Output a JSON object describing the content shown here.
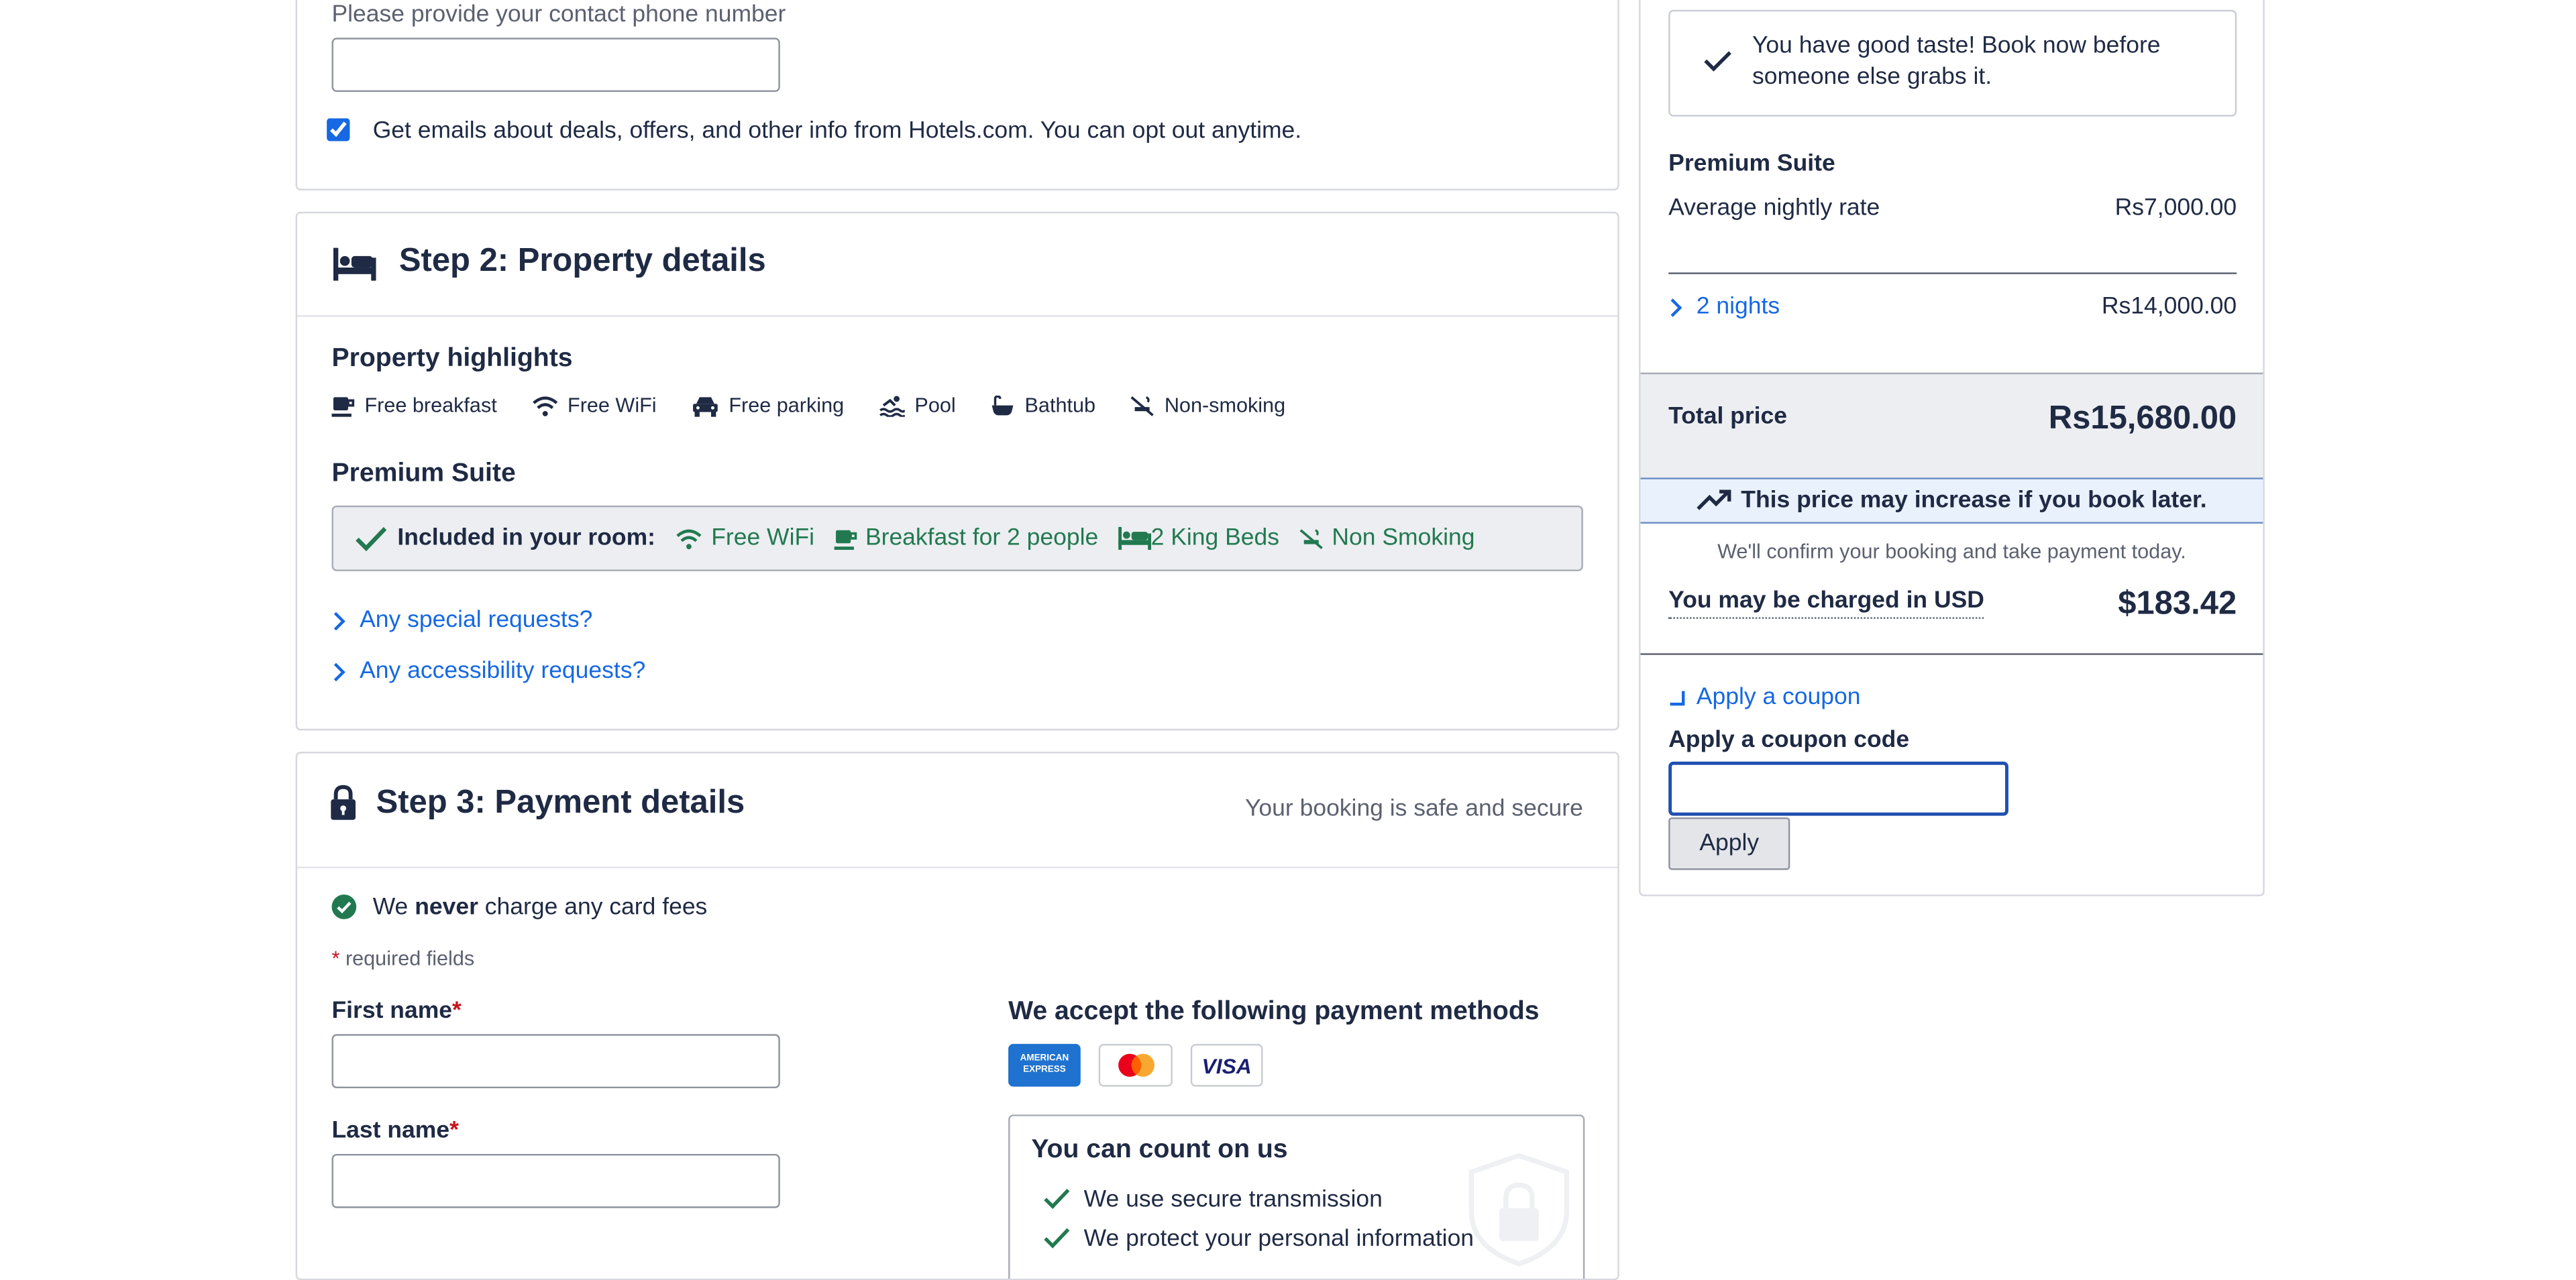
{
  "contact": {
    "phone_label": "Please provide your contact phone number",
    "phone_value": "",
    "email_opt_in_label": "Get emails about deals, offers, and other info from Hotels.com. You can opt out anytime.",
    "email_opt_in_checked": true
  },
  "step2": {
    "title": "Step 2: Property details",
    "highlights_title": "Property highlights",
    "highlights": [
      {
        "label": "Free breakfast",
        "icon": "coffee-icon"
      },
      {
        "label": "Free WiFi",
        "icon": "wifi-icon"
      },
      {
        "label": "Free parking",
        "icon": "car-icon"
      },
      {
        "label": "Pool",
        "icon": "pool-icon"
      },
      {
        "label": "Bathtub",
        "icon": "bathtub-icon"
      },
      {
        "label": "Non-smoking",
        "icon": "no-smoking-icon"
      }
    ],
    "room_title": "Premium Suite",
    "included_label": "Included in your room:",
    "included": [
      {
        "label": "Free WiFi",
        "icon": "wifi-icon"
      },
      {
        "label": "Breakfast for 2 people",
        "icon": "coffee-icon"
      },
      {
        "label": "2 King Beds",
        "icon": "bed-icon"
      },
      {
        "label": "Non Smoking",
        "icon": "no-smoking-icon"
      }
    ],
    "special_requests": "Any special requests?",
    "accessibility_requests": "Any accessibility requests?"
  },
  "step3": {
    "title": "Step 3: Payment details",
    "secure_note": "Your booking is safe and secure",
    "fees_prefix": "We",
    "fees_bold": "never",
    "fees_suffix": "charge any card fees",
    "required_star": "*",
    "required_text": "required fields",
    "first_name_label": "First name",
    "last_name_label": "Last name",
    "methods_title": "We accept the following payment methods",
    "methods": [
      "AMERICAN EXPRESS",
      "Mastercard",
      "VISA"
    ],
    "trust_title": "You can count on us",
    "trust_items": [
      "We use secure transmission",
      "We protect your personal information"
    ]
  },
  "summary": {
    "tip": "You have good taste! Book now before someone else grabs it.",
    "room_name": "Premium Suite",
    "avg_rate_label": "Average nightly rate",
    "avg_rate_value": "Rs7,000.00",
    "nights_label": "2 nights",
    "nights_value": "Rs14,000.00",
    "total_label": "Total price",
    "total_value": "Rs15,680.00",
    "price_increase": "This price may increase if you book later.",
    "confirm_note": "We'll confirm your booking and take payment today.",
    "usd_label": "You may be charged in USD",
    "usd_value": "$183.42",
    "coupon_toggle": "Apply a coupon",
    "coupon_label": "Apply a coupon code",
    "coupon_value": "",
    "apply_button": "Apply"
  },
  "colors": {
    "link": "#1668e3",
    "success": "#227950",
    "text": "#1f2a44",
    "total_bg": "#eceef1",
    "notice_bg": "#e9f1fd"
  }
}
